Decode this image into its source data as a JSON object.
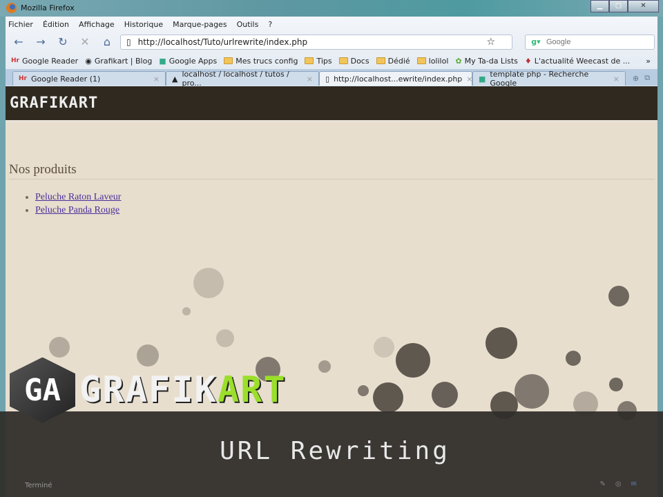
{
  "window": {
    "title": "Mozilla Firefox",
    "controls": [
      "minimize",
      "maximize",
      "close"
    ]
  },
  "menu": [
    "Fichier",
    "Édition",
    "Affichage",
    "Historique",
    "Marque-pages",
    "Outils",
    "?"
  ],
  "nav": {
    "url": "http://localhost/Tuto/urlrewrite/index.php",
    "search_placeholder": "Google"
  },
  "bookmarks": [
    {
      "label": "Google Reader",
      "icon": "google-reader-icon"
    },
    {
      "label": "Grafikart | Blog",
      "icon": "grafikart-icon"
    },
    {
      "label": "Google Apps",
      "icon": "google-icon"
    },
    {
      "label": "Mes trucs config",
      "icon": "folder-icon"
    },
    {
      "label": "Tips",
      "icon": "folder-icon"
    },
    {
      "label": "Docs",
      "icon": "folder-icon"
    },
    {
      "label": "Dédié",
      "icon": "folder-icon"
    },
    {
      "label": "lolilol",
      "icon": "folder-icon"
    },
    {
      "label": "My Ta-da Lists",
      "icon": "tada-icon"
    },
    {
      "label": "L'actualité Weecast de ...",
      "icon": "weecast-icon"
    }
  ],
  "bookmarks_more": "»",
  "tabs": [
    {
      "label": "Google Reader (1)",
      "active": false
    },
    {
      "label": "localhost / localhost / tutos / pro...",
      "active": false
    },
    {
      "label": "http://localhost...ewrite/index.php",
      "active": true
    },
    {
      "label": "template php - Recherche Google",
      "active": false
    }
  ],
  "site": {
    "logo": "GRAFIKART",
    "heading": "Nos produits",
    "products": [
      "Peluche Raton Laveur",
      "Peluche Panda Rouge"
    ]
  },
  "overlay": {
    "logo_mark": "GA",
    "logo_word_a": "GRAFIK",
    "logo_word_b": "ART",
    "title": "URL Rewriting"
  },
  "status": {
    "text": "Terminé"
  }
}
